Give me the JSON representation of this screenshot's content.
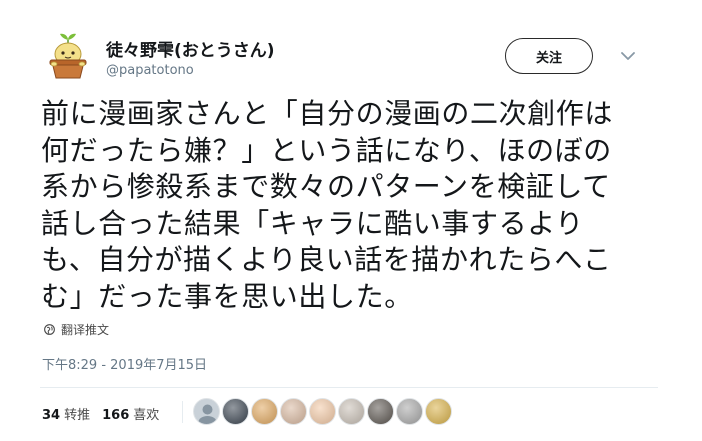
{
  "user": {
    "display_name": "徒々野雫(おとうさん)",
    "handle": "@papatotono"
  },
  "follow_button": {
    "label": "关注"
  },
  "tweet": {
    "text": "前に漫画家さんと「自分の漫画の二次創作は\n何だったら嫌？」という話になり、ほのぼの\n系から惨殺系まで数々のパターンを検証して\n話し合った結果「キャラに酷い事するより\nも、自分が描くより良い話を描かれたらへこ\nむ」だった事を思い出した。",
    "translate_label": "翻译推文",
    "timestamp": "下午8:29 - 2019年7月15日"
  },
  "stats": {
    "retweets": {
      "count": "34",
      "label": "转推"
    },
    "likes": {
      "count": "166",
      "label": "喜欢"
    }
  },
  "likers": [
    {
      "name": "default-avatar",
      "color": "#c9d1d8"
    },
    {
      "name": "dark-art-avatar",
      "color": "#3a4450"
    },
    {
      "name": "orange-avatar",
      "color": "#e0a860"
    },
    {
      "name": "anime-avatar",
      "color": "#d8b8a0"
    },
    {
      "name": "peach-avatar",
      "color": "#f2c9a6"
    },
    {
      "name": "character-avatar",
      "color": "#c8bfb5"
    },
    {
      "name": "dog-avatar",
      "color": "#5c5650"
    },
    {
      "name": "gray-avatar",
      "color": "#a8a8a8"
    },
    {
      "name": "golden-avatar",
      "color": "#d9b24a"
    }
  ],
  "colors": {
    "text": "#14171a",
    "secondary": "#657786",
    "divider": "#e6ecf0"
  }
}
